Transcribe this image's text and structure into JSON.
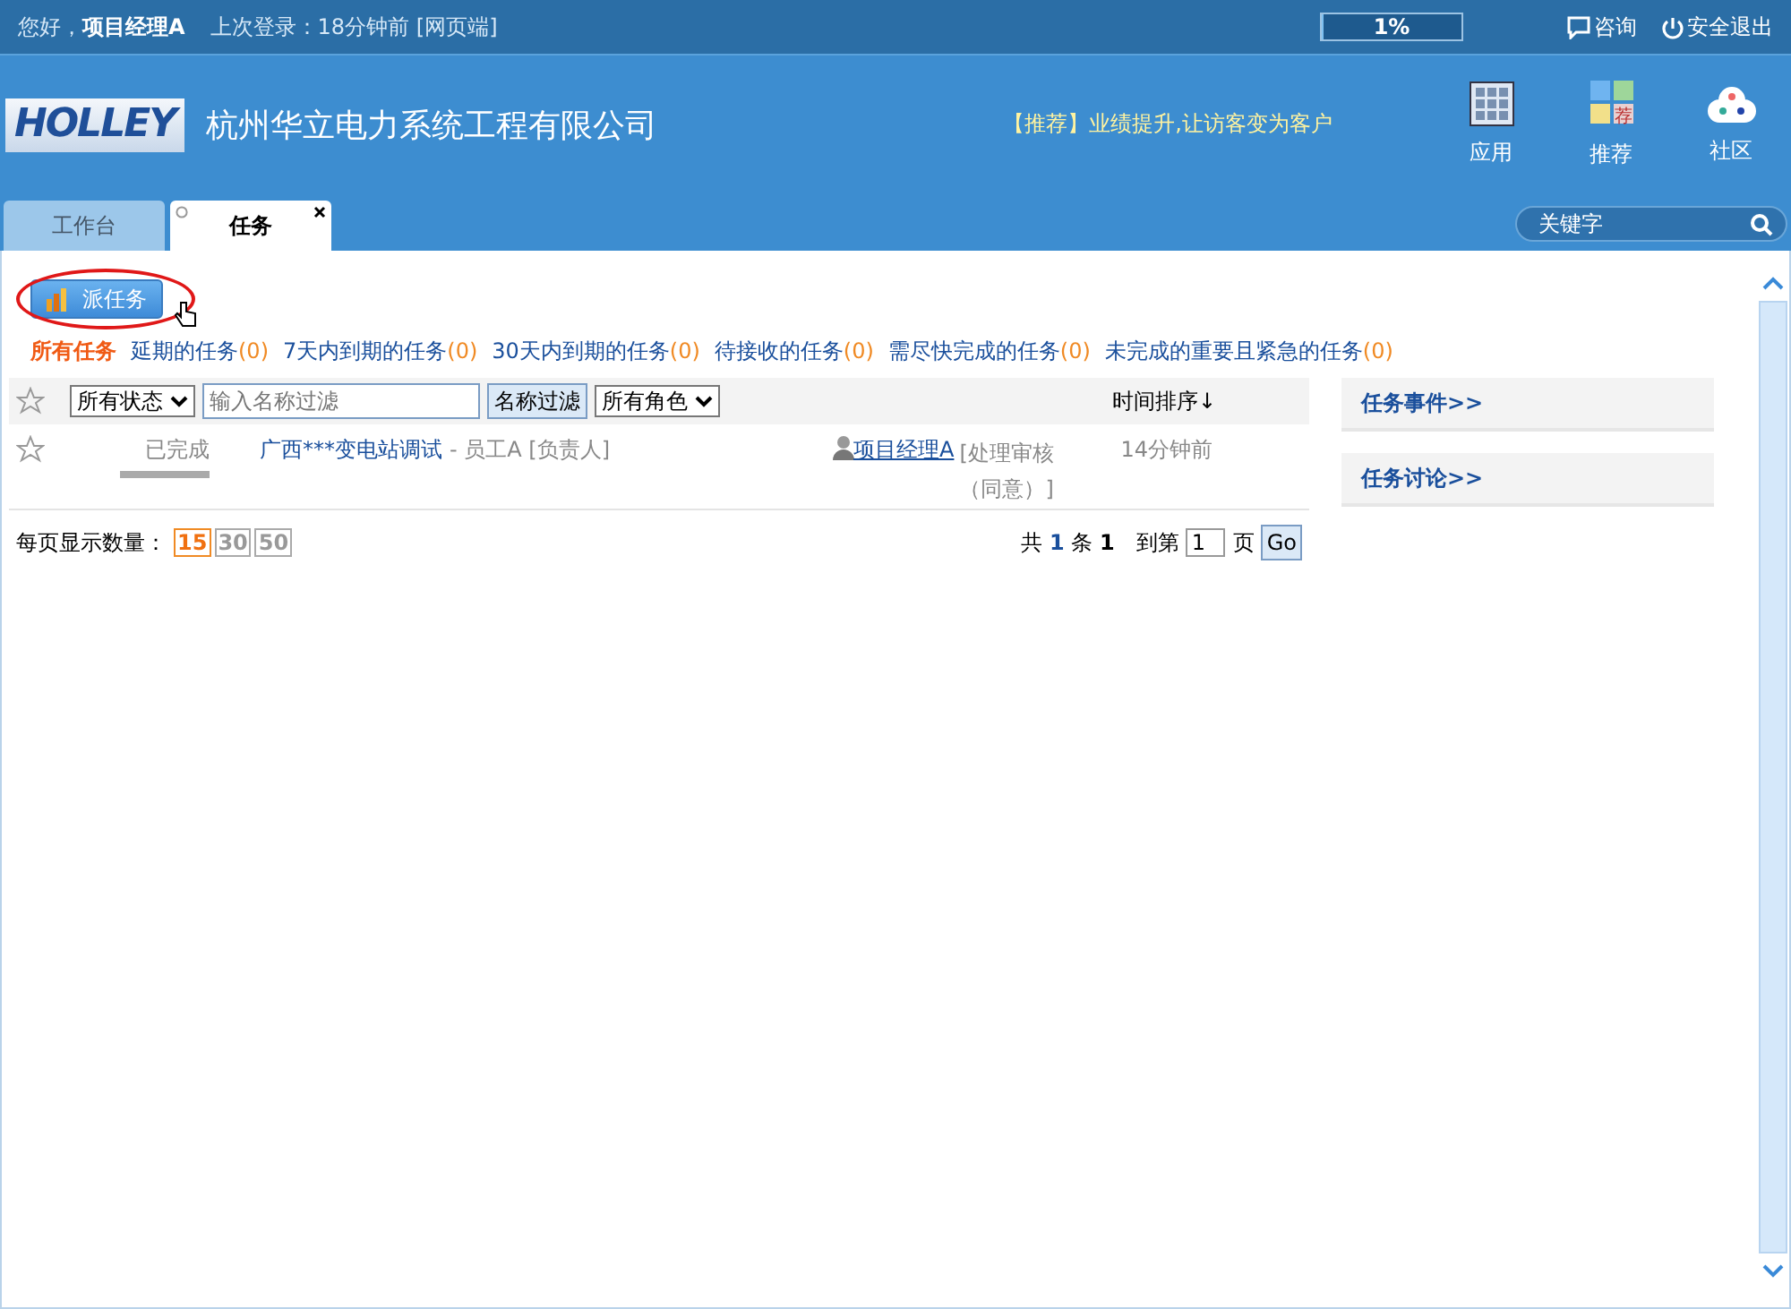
{
  "top_bar": {
    "greeting": "您好，",
    "user": "项目经理A",
    "last_login": "上次登录：18分钟前 [网页端]",
    "storage": {
      "reading": "1%",
      "level": 0.01
    },
    "links": [
      {
        "kind": "chat",
        "label": "咨询"
      },
      {
        "kind": "power",
        "label": "安全退出"
      }
    ]
  },
  "header": {
    "logo": "HOLLEY",
    "company": "杭州华立电力系统工程有限公司",
    "promo": "【推荐】业绩提升,让访客变为客户",
    "apps": [
      {
        "kind": "grid",
        "label": "应用"
      },
      {
        "kind": "tiles",
        "label": "推荐",
        "badge": "荐"
      },
      {
        "kind": "cloud",
        "label": "社区"
      }
    ]
  },
  "tabs": [
    {
      "label": "工作台",
      "selected": false,
      "closable": false
    },
    {
      "label": "任务",
      "selected": true,
      "closable": true
    }
  ],
  "search": {
    "placeholder": "关键字"
  },
  "assign_button": "派任务",
  "filters": [
    {
      "label": "所有任务",
      "selected": true
    },
    {
      "label": "延期的任务",
      "count": "(0)",
      "selected": false
    },
    {
      "label": "7天内到期的任务",
      "count": "(0)",
      "selected": false
    },
    {
      "label": "30天内到期的任务",
      "count": "(0)",
      "selected": false
    },
    {
      "label": "待接收的任务",
      "count": "(0)",
      "selected": false
    },
    {
      "label": "需尽快完成的任务",
      "count": "(0)",
      "selected": false
    },
    {
      "label": "未完成的重要且紧急的任务",
      "count": "(0)",
      "selected": false
    }
  ],
  "toolbar": {
    "status_select": "所有状态",
    "name_placeholder": "输入名称过滤",
    "filter_button": "名称过滤",
    "role_select": "所有角色",
    "sort": "时间排序↓"
  },
  "tasks": [
    {
      "starred": false,
      "status": "已完成",
      "level": 1,
      "title": "广西***变电站调试",
      "assignee": "- 员工A [负责人]",
      "owner": "项目经理A",
      "action": "[处理审核（同意）]",
      "time": "14分钟前"
    }
  ],
  "pager": {
    "label": "每页显示数量：",
    "sizes": [
      {
        "label": "15",
        "selected": true
      },
      {
        "label": "30",
        "selected": false
      },
      {
        "label": "50",
        "selected": false
      }
    ],
    "total_prefix": "共",
    "total": "1",
    "total_unit": "条",
    "page": "1",
    "goto": "到第",
    "page_value": "1",
    "page_unit": "页",
    "go": "Go"
  },
  "side_panels": [
    "任务事件>>",
    "任务讨论>>"
  ]
}
